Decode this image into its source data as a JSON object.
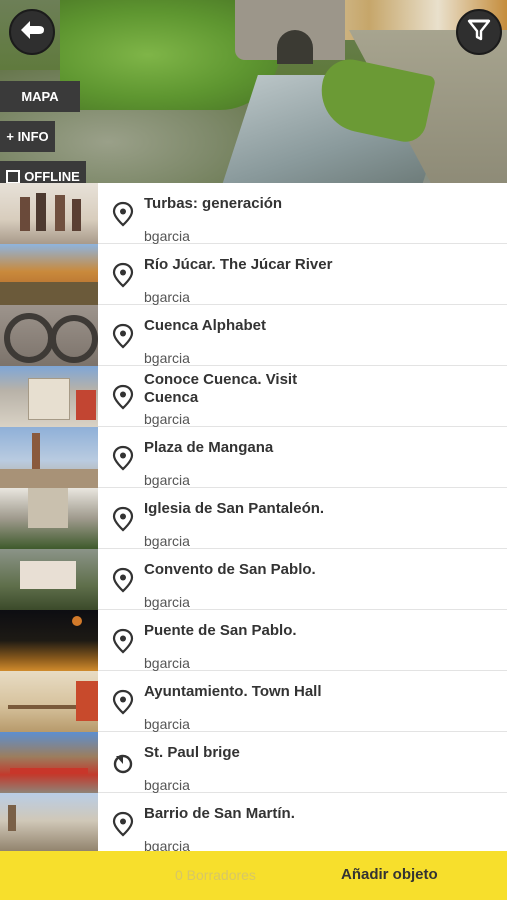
{
  "header": {
    "back_icon": "back-arrow-icon",
    "filter_icon": "filter-funnel-icon"
  },
  "side": {
    "map_label": "MAPA",
    "info_label": "+ INFO",
    "offline_label": "OFFLINE",
    "offline_checked": false
  },
  "items": [
    {
      "title": "Turbas: generación",
      "author": "bgarcia",
      "icon": "location-pin-icon"
    },
    {
      "title": "Río Júcar. The Júcar River",
      "author": "bgarcia",
      "icon": "location-pin-icon"
    },
    {
      "title": "Cuenca Alphabet",
      "author": "bgarcia",
      "icon": "location-pin-icon"
    },
    {
      "title": "Conoce Cuenca. Visit Cuenca",
      "author": "bgarcia",
      "icon": "location-pin-icon"
    },
    {
      "title": "Plaza de Mangana",
      "author": "bgarcia",
      "icon": "location-pin-icon"
    },
    {
      "title": "Iglesia de San Pantaleón.",
      "author": "bgarcia",
      "icon": "location-pin-icon"
    },
    {
      "title": "Convento de San Pablo.",
      "author": "bgarcia",
      "icon": "location-pin-icon"
    },
    {
      "title": "Puente de San Pablo.",
      "author": "bgarcia",
      "icon": "location-pin-icon"
    },
    {
      "title": "Ayuntamiento. Town Hall",
      "author": "bgarcia",
      "icon": "location-pin-icon"
    },
    {
      "title": "St. Paul brige",
      "author": "bgarcia",
      "icon": "route-icon"
    },
    {
      "title": "Barrio de San Martín.",
      "author": "bgarcia",
      "icon": "location-pin-icon"
    }
  ],
  "footer": {
    "drafts_label": "0 Borradores",
    "add_label": "Añadir objeto"
  },
  "colors": {
    "accent_yellow": "#f7df2c",
    "button_dark": "#3a3a3a"
  }
}
